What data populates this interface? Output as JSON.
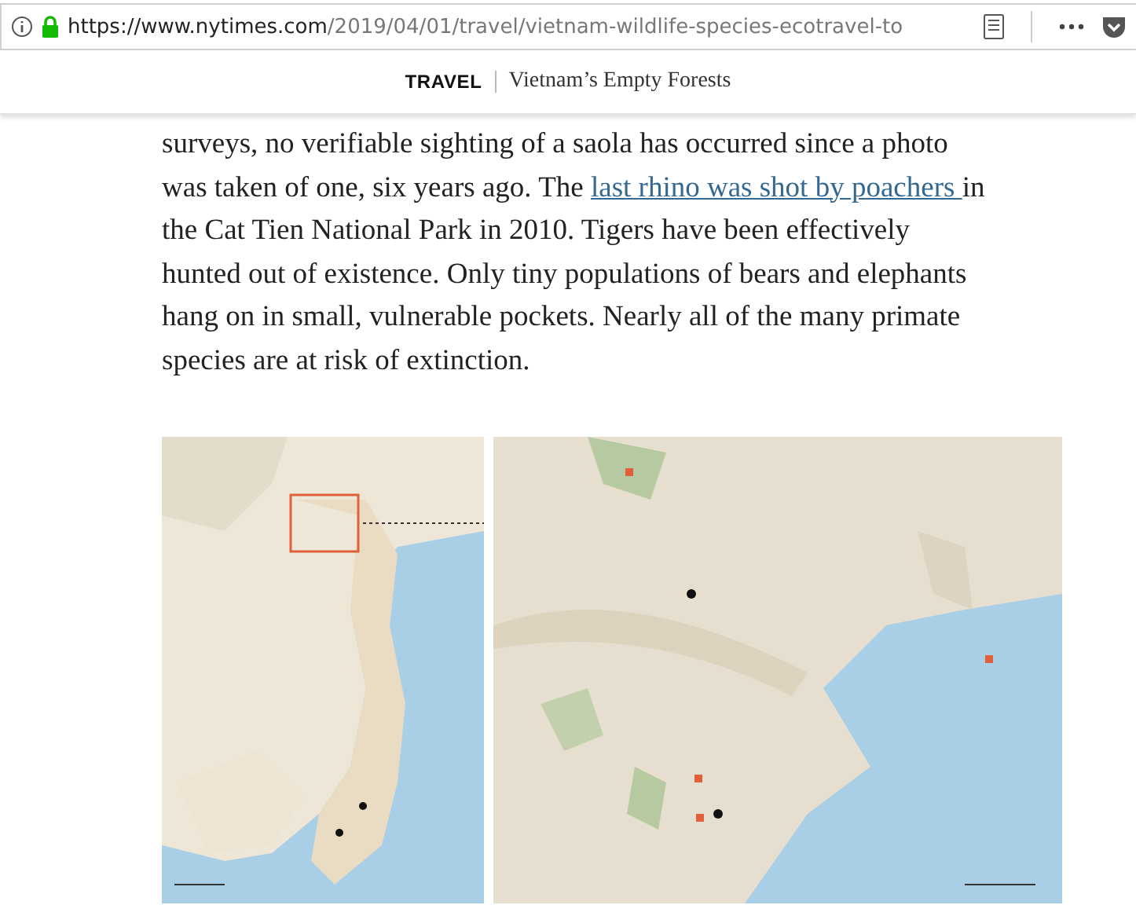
{
  "browser": {
    "url_host": "https://www.nytimes.com",
    "url_path": "/2019/04/01/travel/vietnam-wildlife-species-ecotravel-to",
    "secure": true
  },
  "header": {
    "section": "TRAVEL",
    "title": "Vietnam’s Empty Forests"
  },
  "paragraph": [
    {
      "kind": "text",
      "text": "surveys, no verifiable sighting of a saola has occurred since a photo\nwas taken of one, six years ago. The "
    },
    {
      "kind": "link",
      "text": "last rhino was shot by poachers "
    },
    {
      "kind": "text",
      "text": "in\nthe Cat Tien National Park in 2010. Tigers have been effectively\nhunted out of existence. Only tiny populations of bears and elephants\nhang on in small, vulnerable pockets. Nearly all of the many primate\nspecies are at risk of extinction."
    }
  ]
}
